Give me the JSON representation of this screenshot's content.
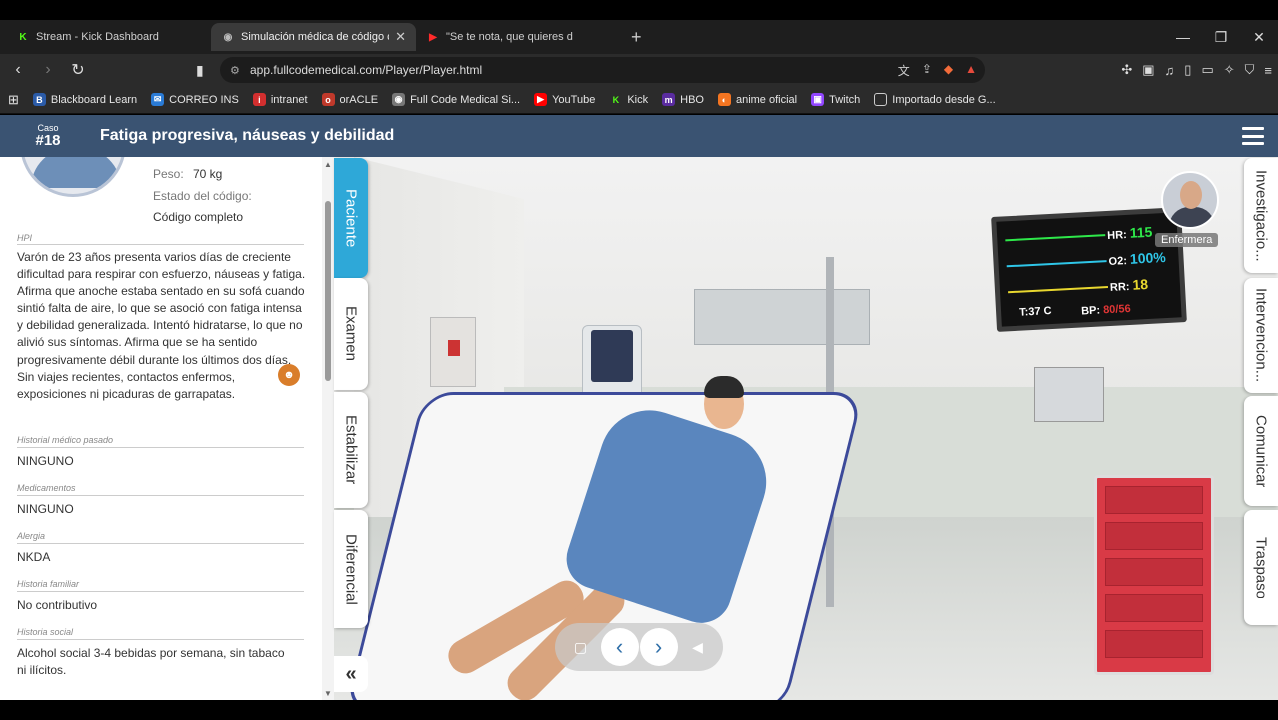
{
  "browser": {
    "tabs": [
      {
        "label": "Stream - Kick Dashboard",
        "icon": "K",
        "icon_color": "#53fc18"
      },
      {
        "label": "Simulación médica de código c",
        "icon": "◉",
        "icon_color": "#888888"
      },
      {
        "label": "\"Se te nota, que quieres d",
        "icon": "▶",
        "icon_color": "#ff0000"
      }
    ],
    "new_tab": "+",
    "url": "app.fullcodemedical.com/Player/Player.html",
    "bookmarks": [
      {
        "label": "Blackboard Learn",
        "color": "#2b5ba8"
      },
      {
        "label": "CORREO INS",
        "color": "#2a7bd6"
      },
      {
        "label": "intranet",
        "color": "#d32f2f"
      },
      {
        "label": "orACLE",
        "color": "#c0392b"
      },
      {
        "label": "Full Code Medical Si...",
        "color": "#777777"
      },
      {
        "label": "YouTube",
        "color": "#ff0000"
      },
      {
        "label": "Kick",
        "color": "#53fc18"
      },
      {
        "label": "HBO",
        "color": "#5a2ca0"
      },
      {
        "label": "anime oficial",
        "color": "#f47521"
      },
      {
        "label": "Twitch",
        "color": "#9146ff"
      },
      {
        "label": "Importado desde G...",
        "color": "#555555"
      }
    ]
  },
  "header": {
    "case_label": "Caso",
    "case_number": "#18",
    "title": "Fatiga progresiva, náuseas y debilidad"
  },
  "patient": {
    "weight_label": "Peso:",
    "weight_value": "70 kg",
    "code_state_label": "Estado del código:",
    "code_state_value": "Código completo",
    "hpi_label": "HPI",
    "hpi_text": "Varón de 23 años presenta varios días de creciente dificultad para respirar con esfuerzo, náuseas y fatiga. Afirma que anoche estaba sentado en su sofá cuando sintió falta de aire, lo que se asoció con fatiga intensa y debilidad generalizada. Intentó hidratarse, lo que no alivió sus síntomas. Afirma que se ha sentido progresivamente débil durante los últimos dos días. Sin viajes recientes, contactos enfermos, exposiciones ni picaduras de garrapatas.",
    "sections": [
      {
        "label": "Historial médico pasado",
        "value": "NINGUNO"
      },
      {
        "label": "Medicamentos",
        "value": "NINGUNO"
      },
      {
        "label": "Alergia",
        "value": "NKDA"
      },
      {
        "label": "Historia familiar",
        "value": "No contributivo"
      },
      {
        "label": "Historia social",
        "value": "Alcohol social 3-4 bebidas por semana, sin tabaco ni ilícitos."
      }
    ]
  },
  "left_tabs": [
    "Paciente",
    "Examen",
    "Estabilizar",
    "Diferencial"
  ],
  "right_tabs": [
    "Investigacio...",
    "Intervencion...",
    "Comunicar",
    "Traspaso"
  ],
  "monitor": {
    "hr_label": "HR:",
    "hr_value": "115",
    "o2_label": "O2:",
    "o2_value": "100%",
    "rr_label": "RR:",
    "rr_value": "18",
    "temp": "T:37 C",
    "bp_label": "BP:",
    "bp_value": "80/56"
  },
  "nurse_label": "Enfermera",
  "collapse_icon": "«",
  "controls": {
    "prev": "‹",
    "next": "›"
  }
}
